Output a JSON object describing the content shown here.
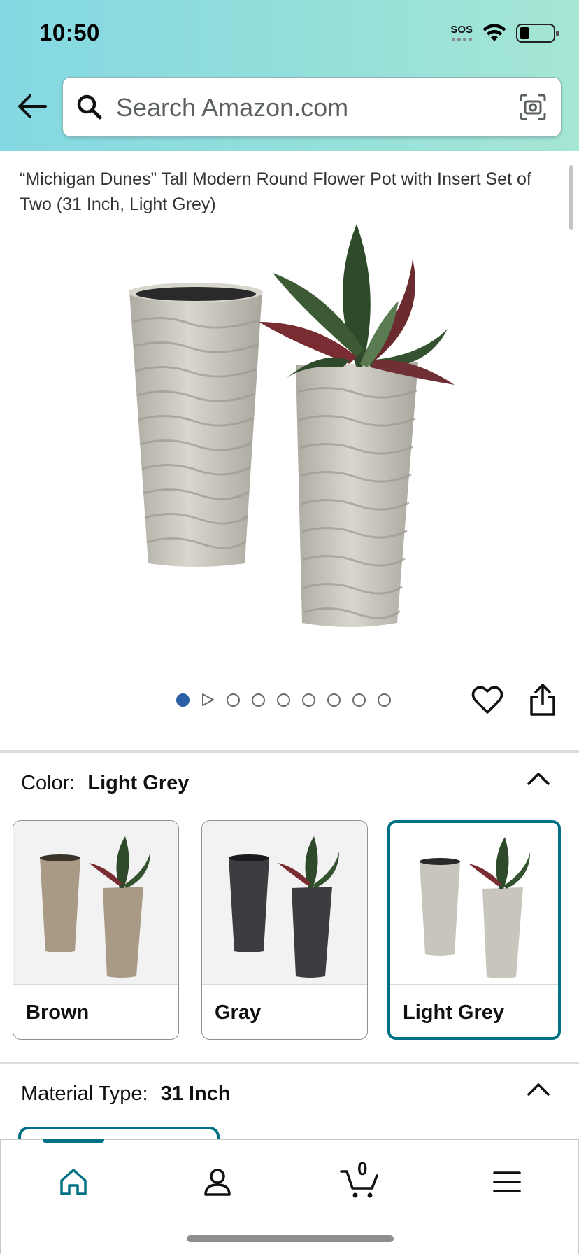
{
  "status_bar": {
    "time": "10:50",
    "sos": "SOS",
    "battery_percent": 25
  },
  "search": {
    "placeholder": "Search Amazon.com"
  },
  "product": {
    "title": "“Michigan Dunes” Tall Modern Round Flower Pot with Insert Set of Two (31 Inch, Light Grey)",
    "image_count": 9,
    "active_image_index": 0,
    "second_slot_is_video": true
  },
  "color": {
    "label": "Color:",
    "selected": "Light Grey",
    "options": [
      {
        "name": "Brown",
        "pot_color": "#a99a86",
        "selected": false
      },
      {
        "name": "Gray",
        "pot_color": "#3c3d41",
        "selected": false
      },
      {
        "name": "Light Grey",
        "pot_color": "#c8c6bc",
        "selected": true
      }
    ]
  },
  "material": {
    "label": "Material Type:",
    "selected": "31 Inch"
  },
  "bottom_nav": {
    "items": [
      {
        "name": "home",
        "icon": "home-icon",
        "active": true
      },
      {
        "name": "account",
        "icon": "person-icon",
        "active": false
      },
      {
        "name": "cart",
        "icon": "cart-icon",
        "active": false
      },
      {
        "name": "menu",
        "icon": "hamburger-icon",
        "active": false
      }
    ],
    "cart_count": "0"
  },
  "colors": {
    "accent": "#007185",
    "dot_active": "#2a5fa4",
    "header_start": "#84d8e3",
    "header_end": "#a5e6d4"
  }
}
